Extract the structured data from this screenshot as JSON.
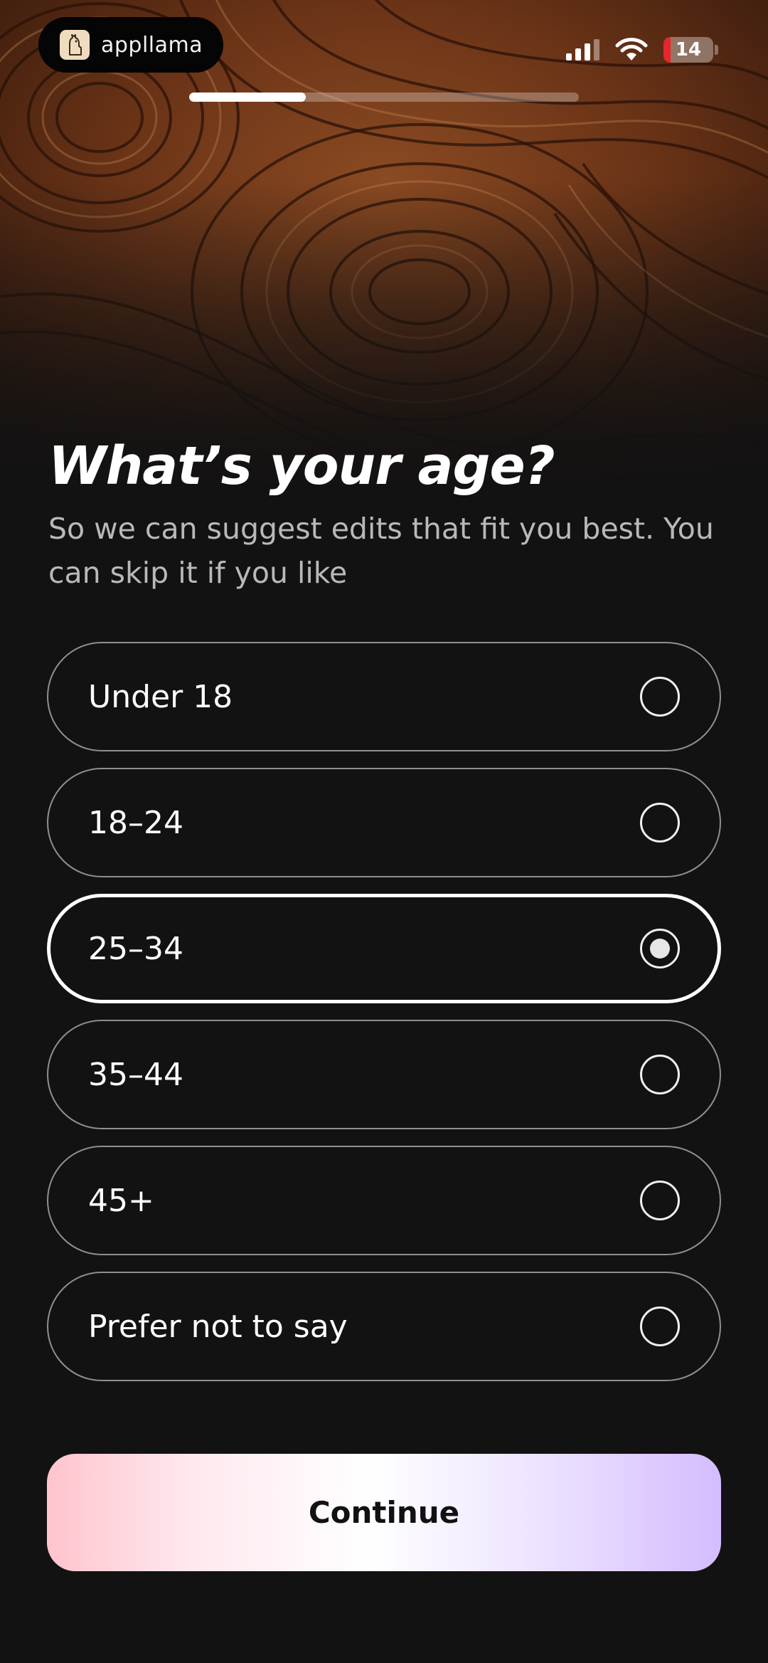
{
  "status_bar": {
    "brand": "appllama",
    "battery": "14",
    "battery_level": 0.14
  },
  "progress": {
    "fraction": 0.3
  },
  "question": {
    "title": "What’s your age?",
    "subtitle": "So we can suggest edits that fit you best. You can skip it if you like"
  },
  "options": [
    {
      "label": "Under 18",
      "selected": false
    },
    {
      "label": "18–24",
      "selected": false
    },
    {
      "label": "25–34",
      "selected": true
    },
    {
      "label": "35–44",
      "selected": false
    },
    {
      "label": "45+",
      "selected": false
    },
    {
      "label": "Prefer not to say",
      "selected": false
    }
  ],
  "continue_label": "Continue",
  "colors": {
    "background": "#121212",
    "button_gradient_start": "#ffc4cd",
    "button_gradient_end": "#d4bdff",
    "battery_fill": "#e5262b"
  },
  "icons": [
    "llama-logo-icon",
    "cellular-signal-icon",
    "wifi-icon",
    "battery-icon",
    "radio-icon"
  ]
}
